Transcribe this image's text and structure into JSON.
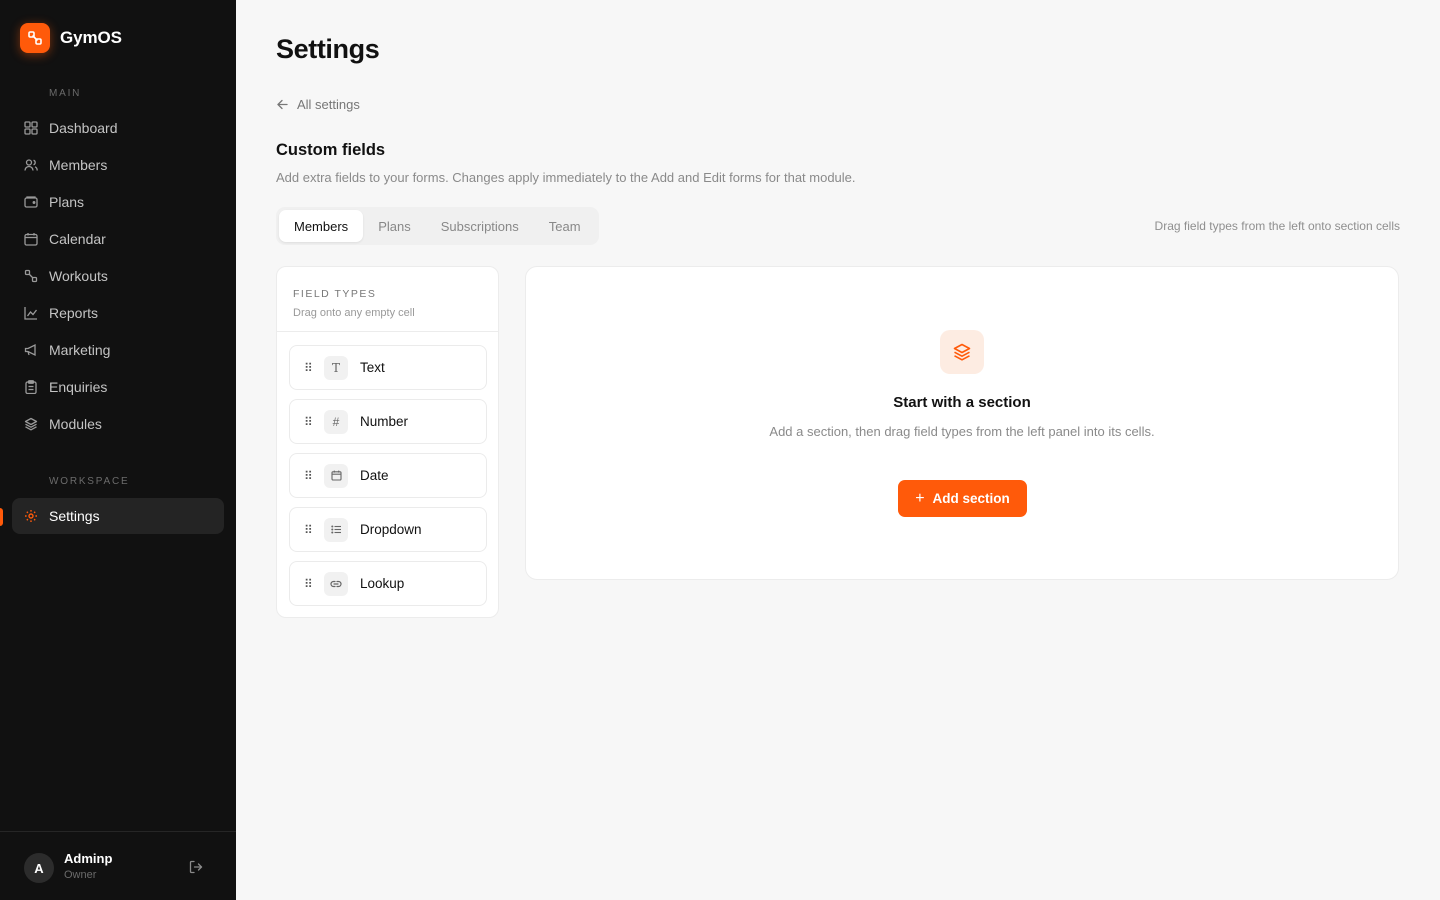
{
  "brand": {
    "name": "GymOS",
    "accent": "#ff5a0a"
  },
  "sidebar": {
    "main_label": "MAIN",
    "workspace_label": "WORKSPACE",
    "items": [
      {
        "label": "Dashboard",
        "icon": "dashboard-icon"
      },
      {
        "label": "Members",
        "icon": "users-icon"
      },
      {
        "label": "Plans",
        "icon": "wallet-icon"
      },
      {
        "label": "Calendar",
        "icon": "calendar-icon"
      },
      {
        "label": "Workouts",
        "icon": "dumbbell-icon"
      },
      {
        "label": "Reports",
        "icon": "chart-line-icon"
      },
      {
        "label": "Marketing",
        "icon": "megaphone-icon"
      },
      {
        "label": "Enquiries",
        "icon": "clipboard-icon"
      },
      {
        "label": "Modules",
        "icon": "layers-icon"
      }
    ],
    "workspace_items": [
      {
        "label": "Settings",
        "icon": "gear-icon",
        "active": true
      }
    ],
    "user": {
      "initial": "A",
      "name": "Adminp",
      "role": "Owner"
    }
  },
  "page": {
    "title": "Settings",
    "back_label": "All settings",
    "section_title": "Custom fields",
    "section_desc": "Add extra fields to your forms. Changes apply immediately to the Add and Edit forms for that module.",
    "drag_hint": "Drag field types from the left onto section cells"
  },
  "tabs": [
    {
      "label": "Members",
      "active": true
    },
    {
      "label": "Plans",
      "active": false
    },
    {
      "label": "Subscriptions",
      "active": false
    },
    {
      "label": "Team",
      "active": false
    }
  ],
  "field_types": {
    "title": "FIELD TYPES",
    "subtitle": "Drag onto any empty cell",
    "items": [
      {
        "label": "Text",
        "icon": "text-type-icon",
        "glyph": "T"
      },
      {
        "label": "Number",
        "icon": "hash-icon",
        "glyph": "#"
      },
      {
        "label": "Date",
        "icon": "calendar-icon",
        "glyph": ""
      },
      {
        "label": "Dropdown",
        "icon": "list-icon",
        "glyph": ""
      },
      {
        "label": "Lookup",
        "icon": "link-icon",
        "glyph": ""
      }
    ]
  },
  "empty_state": {
    "icon": "layers-icon",
    "title": "Start with a section",
    "desc": "Add a section, then drag field types from the left panel into its cells.",
    "button_label": "Add section"
  }
}
